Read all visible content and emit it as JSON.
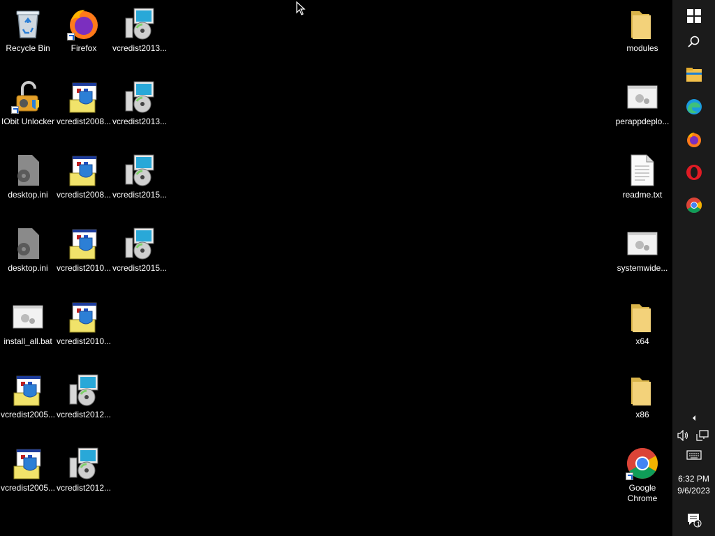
{
  "desktop": {
    "icons": [
      {
        "label": "Recycle Bin",
        "icon": "recycle-bin-icon"
      },
      {
        "label": "Firefox",
        "icon": "firefox-icon"
      },
      {
        "label": "vcredist2013...",
        "icon": "installer-disc-icon"
      },
      {
        "label": "IObit Unlocker",
        "icon": "unlocker-icon"
      },
      {
        "label": "vcredist2008...",
        "icon": "installer-box-icon"
      },
      {
        "label": "vcredist2013...",
        "icon": "installer-disc-icon"
      },
      {
        "label": "desktop.ini",
        "icon": "settings-file-icon"
      },
      {
        "label": "vcredist2008...",
        "icon": "installer-box-icon"
      },
      {
        "label": "vcredist2015...",
        "icon": "installer-disc-icon"
      },
      {
        "label": "desktop.ini",
        "icon": "settings-file-icon"
      },
      {
        "label": "vcredist2010...",
        "icon": "installer-box-icon"
      },
      {
        "label": "vcredist2015...",
        "icon": "installer-disc-icon"
      },
      {
        "label": "install_all.bat",
        "icon": "batch-file-icon"
      },
      {
        "label": "vcredist2010...",
        "icon": "installer-box-icon"
      },
      {
        "label": "vcredist2005...",
        "icon": "installer-box-icon"
      },
      {
        "label": "vcredist2012...",
        "icon": "installer-disc-icon"
      },
      {
        "label": "vcredist2005...",
        "icon": "installer-box-icon"
      },
      {
        "label": "vcredist2012...",
        "icon": "installer-disc-icon"
      },
      {
        "label": "modules",
        "icon": "folder-icon"
      },
      {
        "label": "perappdeplo...",
        "icon": "batch-file-icon"
      },
      {
        "label": "readme.txt",
        "icon": "text-file-icon"
      },
      {
        "label": "systemwide...",
        "icon": "batch-file-icon"
      },
      {
        "label": "x64",
        "icon": "folder-icon"
      },
      {
        "label": "x86",
        "icon": "folder-icon"
      },
      {
        "label": "Google Chrome",
        "icon": "chrome-icon"
      }
    ]
  },
  "taskbar": {
    "pinned": [
      "start-button",
      "search-button",
      "file-explorer",
      "edge",
      "firefox",
      "opera",
      "chrome"
    ],
    "time": "6:32 PM",
    "date": "9/6/2023",
    "notification_count": "1"
  },
  "colors": {
    "desktop_bg": "#000000",
    "taskbar_bg": "#1b1b1b",
    "folder": "#f3d27a"
  }
}
